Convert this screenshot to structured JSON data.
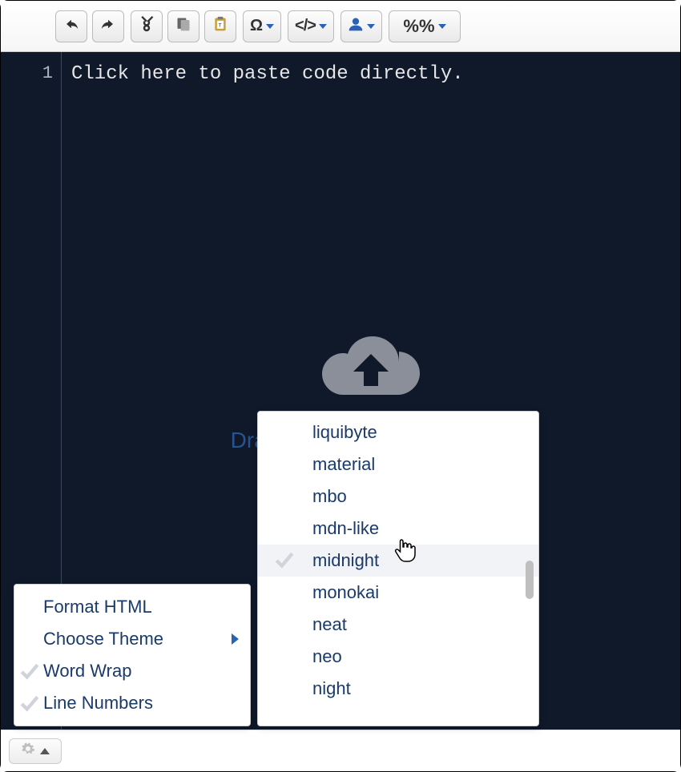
{
  "toolbar": {
    "undo_icon": "undo",
    "redo_icon": "redo",
    "cut_icon": "cut",
    "copy_icon": "copy",
    "paste_icon": "paste",
    "special_char_label": "Ω",
    "code_view_label": "</>",
    "user_icon": "user",
    "variable_label": "%%"
  },
  "editor": {
    "line_number": "1",
    "placeholder_text": "Click here to paste code directly.",
    "drop_hint": "Drag text or HTML files here"
  },
  "settings_menu": {
    "items": [
      {
        "label": "Format HTML",
        "checked": false,
        "submenu": false
      },
      {
        "label": "Choose Theme",
        "checked": false,
        "submenu": true
      },
      {
        "label": "Word Wrap",
        "checked": true,
        "submenu": false
      },
      {
        "label": "Line Numbers",
        "checked": true,
        "submenu": false
      }
    ]
  },
  "theme_menu": {
    "items": [
      {
        "label": "liquibyte",
        "selected": false,
        "hovered": false
      },
      {
        "label": "material",
        "selected": false,
        "hovered": false
      },
      {
        "label": "mbo",
        "selected": false,
        "hovered": false
      },
      {
        "label": "mdn-like",
        "selected": false,
        "hovered": false
      },
      {
        "label": "midnight",
        "selected": true,
        "hovered": true
      },
      {
        "label": "monokai",
        "selected": false,
        "hovered": false
      },
      {
        "label": "neat",
        "selected": false,
        "hovered": false
      },
      {
        "label": "neo",
        "selected": false,
        "hovered": false
      },
      {
        "label": "night",
        "selected": false,
        "hovered": false
      }
    ]
  },
  "colors": {
    "editor_bg": "#0f192a",
    "accent": "#2a63b5",
    "menu_text": "#1a3a6a"
  }
}
